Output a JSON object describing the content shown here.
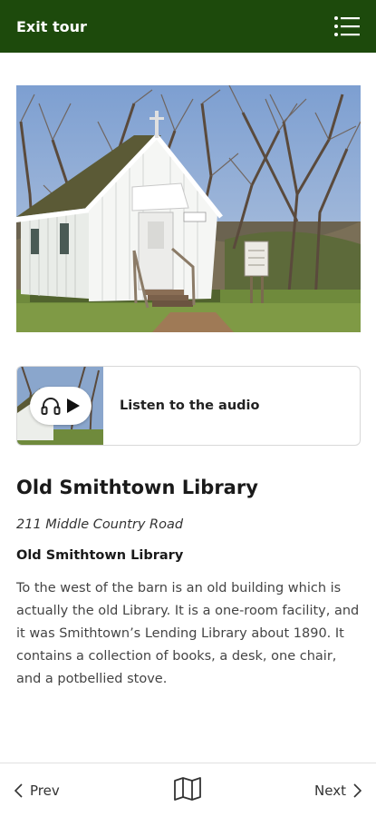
{
  "header": {
    "exit_label": "Exit tour",
    "menu_icon": "list-menu-icon",
    "background": "#1d4a0c"
  },
  "hero": {
    "image_icon": "historic-library-building-photo"
  },
  "audio": {
    "label": "Listen to the audio",
    "icons": [
      "headphones-icon",
      "play-icon"
    ]
  },
  "stop": {
    "title": "Old Smithtown Library",
    "address": "211 Middle Country Road",
    "subheading": "Old Smithtown Library",
    "description": "To the west of the barn is an old building which is actually the old Library. It is a one-room facility, and it was Smithtown’s Lending Library about 1890. It contains a collection of books, a desk, one chair, and a potbellied stove."
  },
  "footer": {
    "prev_label": "Prev",
    "next_label": "Next",
    "map_icon": "map-icon"
  }
}
